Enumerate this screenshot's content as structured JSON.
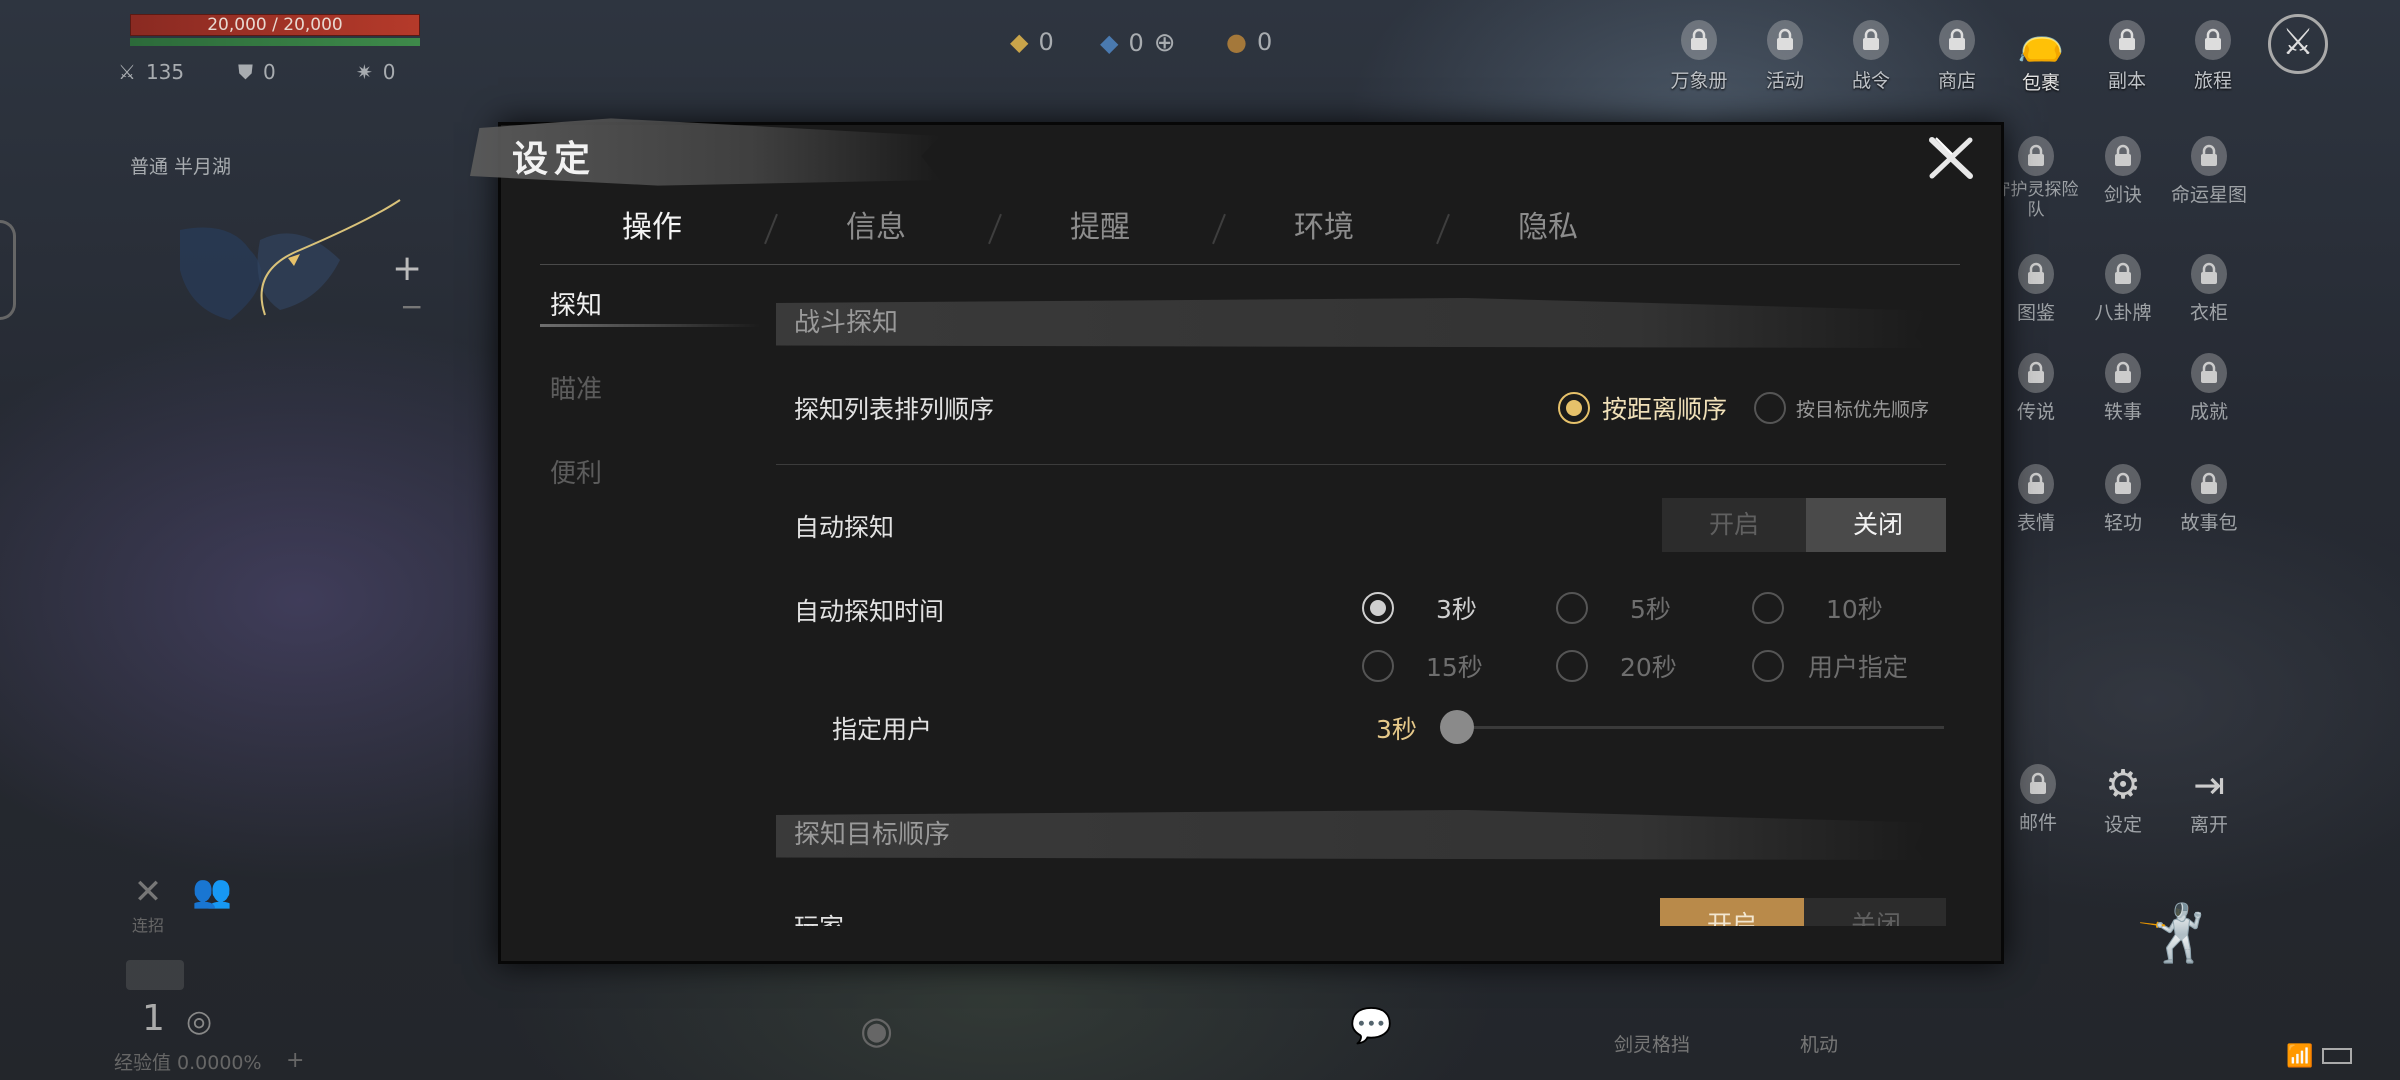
{
  "hud": {
    "hp": "20,000 / 20,000",
    "stats": {
      "attack": "135",
      "defense": "0",
      "extra": "0"
    },
    "location": "普通  半月湖",
    "exp": "经验值 0.0000%",
    "level": "1",
    "bottom_left_label": "连招"
  },
  "currencies": [
    {
      "icon": "gold-diamond-icon",
      "value": "0"
    },
    {
      "icon": "blue-diamond-icon",
      "value": "0"
    },
    {
      "icon": "coin-pouch-icon",
      "value": "0"
    }
  ],
  "top_menu": [
    {
      "label": "万象册",
      "icon": "lock-icon"
    },
    {
      "label": "活动",
      "icon": "lock-icon"
    },
    {
      "label": "战令",
      "icon": "lock-icon"
    },
    {
      "label": "商店",
      "icon": "lock-icon"
    },
    {
      "label": "包裹",
      "icon": "bag-icon"
    },
    {
      "label": "副本",
      "icon": "lock-icon"
    },
    {
      "label": "旅程",
      "icon": "lock-icon"
    }
  ],
  "right_menu": [
    [
      "守护灵探险队",
      "剑诀",
      "命运星图"
    ],
    [
      "图鉴",
      "八卦牌",
      "衣柜"
    ],
    [
      "传说",
      "轶事",
      "成就"
    ],
    [
      "表情",
      "轻功",
      "故事包"
    ]
  ],
  "right_bottom": [
    {
      "label": "邮件",
      "icon": "lock-icon"
    },
    {
      "label": "设定",
      "icon": "gear-icon"
    },
    {
      "label": "离开",
      "icon": "exit-icon"
    }
  ],
  "bottom_bar": {
    "skill1": "剑灵格挡",
    "skill2": "机动"
  },
  "dialog": {
    "title": "设定",
    "tabs": [
      "操作",
      "信息",
      "提醒",
      "环境",
      "隐私"
    ],
    "active_tab": 0,
    "side": [
      "探知",
      "瞄准",
      "便利"
    ],
    "section1": "战斗探知",
    "sort_label": "探知列表排列顺序",
    "sort_opt1": "按距离顺序",
    "sort_opt2": "按目标优先顺序",
    "auto_label": "自动探知",
    "toggle_on": "开启",
    "toggle_off": "关闭",
    "auto_time_label": "自动探知时间",
    "time_opts": [
      "3秒",
      "5秒",
      "10秒",
      "15秒",
      "20秒",
      "用户指定"
    ],
    "user_label": "指定用户",
    "user_value": "3秒",
    "slider_fraction": 0,
    "section2": "探知目标顺序",
    "player_label": "玩家",
    "player_on": "开启",
    "player_off": "关闭"
  },
  "colors": {
    "accent_gold": "#e6c16a",
    "toggle_gold": "#b98a4a",
    "hp_red": "#b53a2a"
  }
}
